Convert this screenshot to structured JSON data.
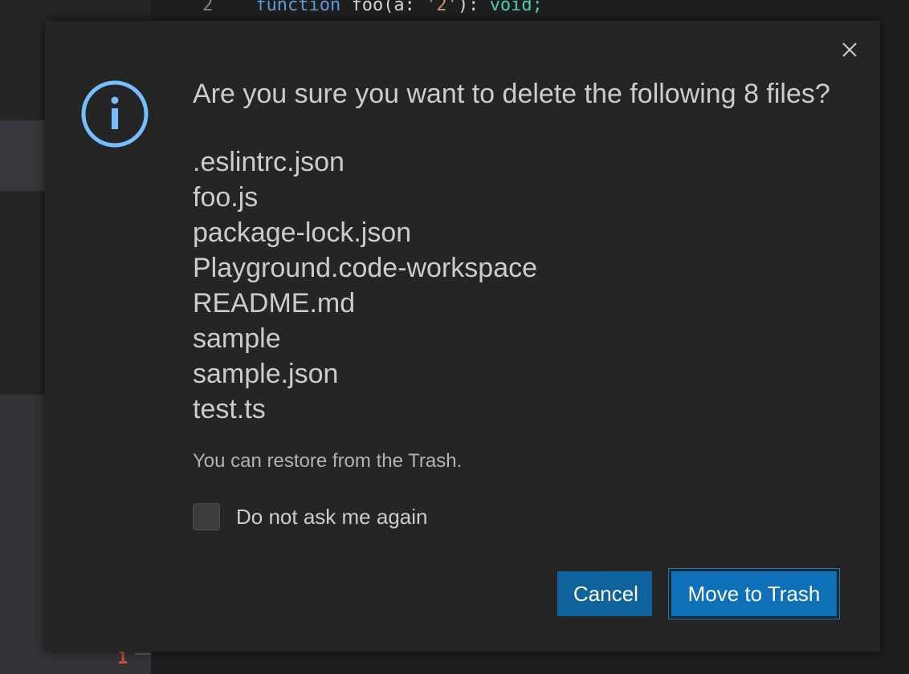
{
  "background": {
    "code_line": {
      "line_number": "2",
      "keyword": "function",
      "name": "foo(a:",
      "string": "'2'",
      "rest": "):",
      "type": "void;"
    },
    "gutter_number": "1"
  },
  "dialog": {
    "title": "Are you sure you want to delete the following 8 files?",
    "files": [
      ".eslintrc.json",
      "foo.js",
      "package-lock.json",
      "Playground.code-workspace",
      "README.md",
      "sample",
      "sample.json",
      "test.ts"
    ],
    "detail": "You can restore from the Trash.",
    "checkbox_label": "Do not ask me again",
    "checkbox_checked": false,
    "buttons": {
      "cancel": "Cancel",
      "primary": "Move to Trash"
    },
    "icons": {
      "info": "info-icon",
      "close": "close-icon"
    }
  },
  "colors": {
    "accent": "#0e639c",
    "info": "#75beff",
    "dialog_bg": "#252526"
  }
}
